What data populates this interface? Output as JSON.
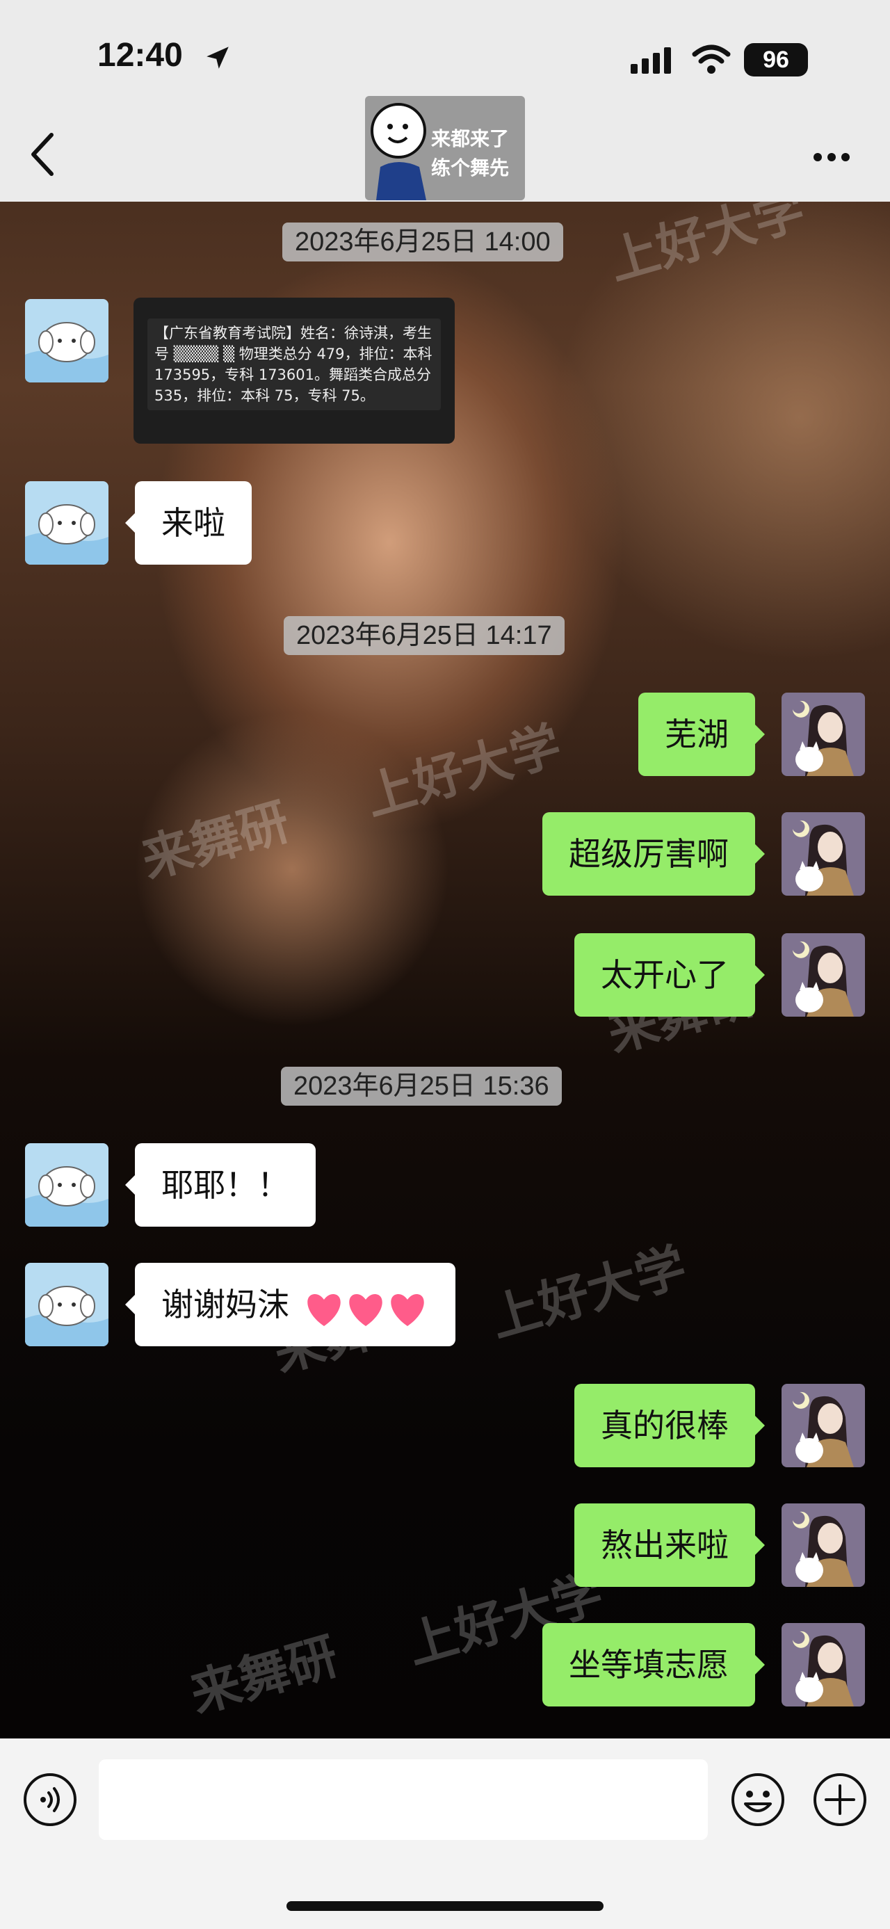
{
  "status_bar": {
    "time": "12:40",
    "battery": "96"
  },
  "nav": {
    "sticker_line1": "来都来了",
    "sticker_line2": "练个舞先"
  },
  "messages": {
    "ts1": "2023年6月25日 14:00",
    "sms": "【广东省教育考试院】姓名：徐诗淇，考生号 ▒▒▒▒ ▒ 物理类总分 479，排位：本科 173595，专科 173601。舞蹈类合成总分 535，排位：本科 75，专科 75。",
    "m1": "来啦",
    "ts2": "2023年6月25日 14:17",
    "m2": "芜湖",
    "m3": "超级厉害啊",
    "m4": "太开心了",
    "ts3": "2023年6月25日 15:36",
    "m5": "耶耶！！",
    "m6": "谢谢妈沫",
    "m7": "真的很棒",
    "m8": "熬出来啦",
    "m9": "坐等填志愿"
  },
  "watermarks": [
    "来舞研",
    "上好大学"
  ],
  "colors": {
    "self_bubble": "#95ec69",
    "other_bubble": "#ffffff"
  }
}
